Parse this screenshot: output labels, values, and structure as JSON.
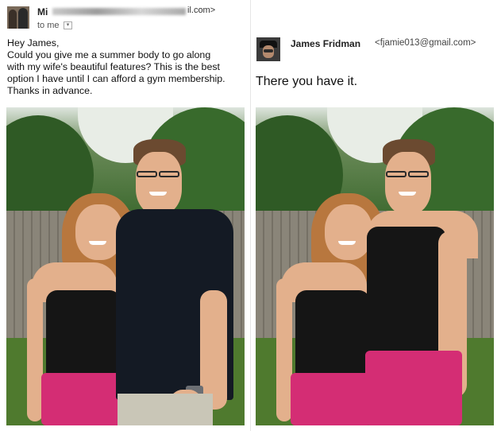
{
  "email": {
    "sender_prefix": "Mi",
    "sender_domain": "il.com>",
    "to_line": "to me",
    "message_lines": [
      "Hey James,",
      "Could you give me a summer body to go along",
      "with my wife's beautiful features? This is the best",
      "option I have until I can afford a gym membership.",
      "Thanks in advance."
    ]
  },
  "reply": {
    "name": "James Fridman",
    "email": "<fjamie013@gmail.com>",
    "text": "There you have it."
  },
  "icons": {
    "to_dropdown": "chevron-down-icon",
    "caret_glyph": "▾"
  },
  "colors": {
    "shorts": "#d42d74",
    "tank_top": "#151515",
    "shirt": "#141a24",
    "grass": "#4f7a2e"
  }
}
